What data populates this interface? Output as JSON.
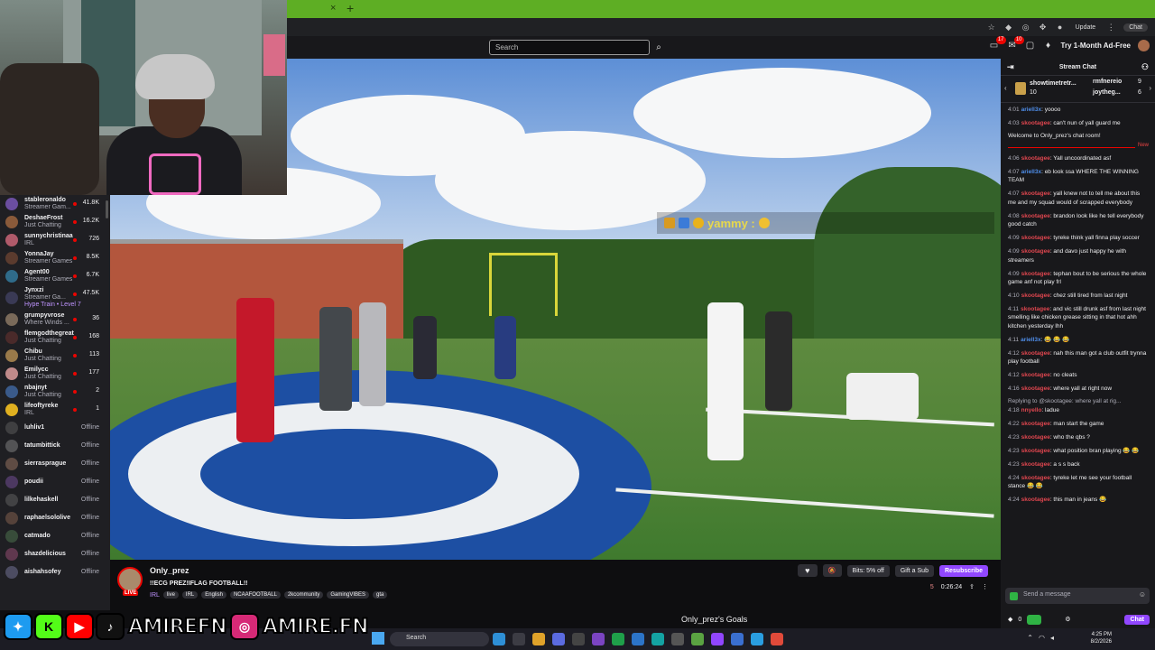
{
  "browser": {
    "tab_close": "×",
    "tab_new": "+",
    "update_label": "Update",
    "chat_label": "Chat"
  },
  "topnav": {
    "search_placeholder": "Search",
    "notifications_count": "17",
    "inbox_count": "10",
    "adfree_label": "Try 1-Month Ad-Free"
  },
  "overlay": {
    "chat_text": "yammy :"
  },
  "sidebar": {
    "items": [
      {
        "name": "stableronaldo",
        "game": "Streamer Gam...",
        "viewers": "41.8K",
        "color": "#6b4ea0"
      },
      {
        "name": "DeshaeFrost",
        "game": "Just Chatting",
        "viewers": "16.2K",
        "color": "#8a5a3a"
      },
      {
        "name": "sunnychristinaa",
        "game": "IRL",
        "viewers": "726",
        "color": "#b05a6a"
      },
      {
        "name": "YonnaJay",
        "game": "Streamer Games",
        "viewers": "8.5K",
        "color": "#5b3b2e"
      },
      {
        "name": "Agent00",
        "game": "Streamer Games",
        "viewers": "6.7K",
        "color": "#2f6b8a"
      },
      {
        "name": "Jynxzi",
        "game": "Streamer Ga...",
        "viewers": "47.5K",
        "color": "#3a3a55",
        "extra": "Hype Train • Level 7"
      },
      {
        "name": "grumpyvrose",
        "game": "Where Winds ...",
        "viewers": "36",
        "color": "#7a6a5a"
      },
      {
        "name": "flemgodthegreat",
        "game": "Just Chatting",
        "viewers": "168",
        "color": "#4a2a2a"
      },
      {
        "name": "Chibu",
        "game": "Just Chatting",
        "viewers": "113",
        "color": "#9a7a4a"
      },
      {
        "name": "Emilycc",
        "game": "Just Chatting",
        "viewers": "177",
        "color": "#c08a8a"
      },
      {
        "name": "nbajnyt",
        "game": "Just Chatting",
        "viewers": "2",
        "color": "#3a5a8a"
      },
      {
        "name": "lifeoftyreke",
        "game": "IRL",
        "viewers": "1",
        "color": "#e0b020"
      }
    ],
    "offline": [
      {
        "name": "luhliv1",
        "status": "Offline",
        "color": "#555"
      },
      {
        "name": "tatumbittick",
        "status": "Offline",
        "color": "#777"
      },
      {
        "name": "sierrasprague",
        "status": "Offline",
        "color": "#8a6a5a"
      },
      {
        "name": "poudii",
        "status": "Offline",
        "color": "#6a4a8a"
      },
      {
        "name": "lilkehaskell",
        "status": "Offline",
        "color": "#5a5a5a"
      },
      {
        "name": "raphaelsololive",
        "status": "Offline",
        "color": "#7a5a4a"
      },
      {
        "name": "catmado",
        "status": "Offline",
        "color": "#4a6a4a"
      },
      {
        "name": "shazdelicious",
        "status": "Offline",
        "color": "#8a4a6a"
      },
      {
        "name": "aishahsofey",
        "status": "Offline",
        "color": "#6a6a8a"
      }
    ]
  },
  "channel": {
    "name": "Only_prez",
    "live": "LIVE",
    "title": "!!ECG PREZ!IFLAG FOOTBALL!!",
    "category": "IRL",
    "tags": [
      "live",
      "IRL",
      "English",
      "NCAAFOOTBALL",
      "2kcommunity",
      "GamingVIBES",
      "gta"
    ],
    "bits_label": "Bits: 5% off",
    "gift_label": "Gift a Sub",
    "resub_label": "Resubscribe",
    "viewers": "5",
    "uptime": "0:26:24",
    "goals_label": "Only_prez's Goals"
  },
  "chat": {
    "title": "Stream Chat",
    "leaderboard": [
      {
        "name": "showtimetretr...",
        "count": "10"
      },
      {
        "name": "rmfnereio",
        "count": "9"
      },
      {
        "name": "joytheg...",
        "count": "6"
      }
    ],
    "welcome": "Welcome to Only_prez's chat room!",
    "new_label": "New",
    "reply_to": "Replying to @skootagee: where yall at rig...",
    "messages_before": [
      {
        "time": "4:01",
        "user": "ariell3x",
        "color": "#4f8eea",
        "text": ": yoooo"
      },
      {
        "time": "4:03",
        "user": "skootagee",
        "color": "#e0464f",
        "text": ": can't nun of yall guard me"
      }
    ],
    "messages_after": [
      {
        "time": "4:06",
        "user": "skootagee",
        "color": "#e0464f",
        "text": ": Yall uncoordinated asf"
      },
      {
        "time": "4:07",
        "user": "ariell3x",
        "color": "#4f8eea",
        "text": ": eb look ssa WHERE THE WINNING TEAM"
      },
      {
        "time": "4:07",
        "user": "skootagee",
        "color": "#e0464f",
        "text": ": yall knew not to tell me about this me and my squad would of scrapped everybody"
      },
      {
        "time": "4:08",
        "user": "skootagee",
        "color": "#e0464f",
        "text": ": brandon look like he tell everybody good catch"
      },
      {
        "time": "4:09",
        "user": "skootagee",
        "color": "#e0464f",
        "text": ": tyreke think yall finna play soccer"
      },
      {
        "time": "4:09",
        "user": "skootagee",
        "color": "#e0464f",
        "text": ": and davo just happy he with streamers"
      },
      {
        "time": "4:09",
        "user": "skootagee",
        "color": "#e0464f",
        "text": ": tephan bout to be serious the whole game anf not play frl"
      },
      {
        "time": "4:10",
        "user": "skootagee",
        "color": "#e0464f",
        "text": ": chez still tired from last night"
      },
      {
        "time": "4:11",
        "user": "skootagee",
        "color": "#e0464f",
        "text": ": and vic still drunk asf from last night smelling like chicken grease sitting in that hot ahh kitchen yesterday lhh"
      },
      {
        "time": "4:11",
        "user": "ariell3x",
        "color": "#4f8eea",
        "text": ": 😂 😂 😂"
      },
      {
        "time": "4:12",
        "user": "skootagee",
        "color": "#e0464f",
        "text": ": nah this man got a club outfit trynna play football"
      },
      {
        "time": "4:12",
        "user": "skootagee",
        "color": "#e0464f",
        "text": ": no cleats"
      },
      {
        "time": "4:16",
        "user": "skootagee",
        "color": "#e0464f",
        "text": ": where yall at right now"
      }
    ],
    "reply_msg": {
      "time": "4:18",
      "user": "nnyello",
      "color": "#e0464f",
      "text": ": ladue"
    },
    "messages_end": [
      {
        "time": "4:22",
        "user": "skootagee",
        "color": "#e0464f",
        "text": ": man start the game"
      },
      {
        "time": "4:23",
        "user": "skootagee",
        "color": "#e0464f",
        "text": ": who the qbs ?"
      },
      {
        "time": "4:23",
        "user": "skootagee",
        "color": "#e0464f",
        "text": ": what position bran playing 😂 😂"
      },
      {
        "time": "4:23",
        "user": "skootagee",
        "color": "#e0464f",
        "text": ": a s s back"
      },
      {
        "time": "4:24",
        "user": "skootagee",
        "color": "#e0464f",
        "text": ": tyreke let me see your football stance 😂 😂"
      },
      {
        "time": "4:24",
        "user": "skootagee",
        "color": "#e0464f",
        "text": ": this man in jeans 😂"
      }
    ],
    "input_placeholder": "Send a message",
    "points": "0",
    "chat_button": "Chat"
  },
  "taskbar": {
    "search_label": "Search",
    "time": "4:25 PM",
    "date": "8/2/2026"
  },
  "socials": {
    "handle1": "AMIREFN",
    "handle2": "AMIRE.FN"
  }
}
